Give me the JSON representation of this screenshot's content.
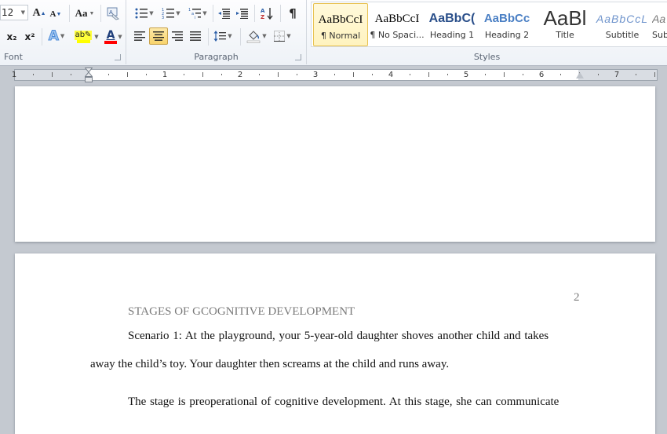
{
  "ribbon": {
    "font_group": {
      "label": "Font",
      "font_size": "12",
      "grow_font": "A",
      "shrink_font": "A",
      "change_case": "Aa",
      "subscript": "x₂",
      "superscript": "x²",
      "text_effects": "A",
      "highlight": "ab",
      "font_color": "A",
      "highlight_color": "#ffff00",
      "font_color_value": "#ff0000"
    },
    "paragraph_group": {
      "label": "Paragraph",
      "pilcrow": "¶",
      "active_alignment": "center"
    },
    "styles_group": {
      "label": "Styles",
      "items": [
        {
          "preview": "AaBbCcI",
          "name": "¶ Normal",
          "selected": true
        },
        {
          "preview": "AaBbCcI",
          "name": "¶ No Spaci...",
          "selected": false
        },
        {
          "preview": "AaBbC(",
          "name": "Heading 1",
          "selected": false
        },
        {
          "preview": "AaBbCc",
          "name": "Heading 2",
          "selected": false
        },
        {
          "preview": "AaBl",
          "name": "Title",
          "selected": false
        },
        {
          "preview": "AaBbCcL",
          "name": "Subtitle",
          "selected": false
        },
        {
          "preview": "Aa",
          "name": "Sub",
          "selected": false
        }
      ]
    }
  },
  "ruler": {
    "numbers": [
      "1",
      "1",
      "2",
      "3",
      "4",
      "5",
      "6",
      "7"
    ]
  },
  "document": {
    "page_number": "2",
    "running_head": "STAGES OF GCOGNITIVE DEVELOPMENT",
    "paragraphs": [
      {
        "lines": [
          "Scenario 1: At the playground, your 5-year-old daughter shoves another child and takes",
          "away the child’s toy. Your daughter then screams at the child and runs away."
        ]
      },
      {
        "lines": [
          "The stage is preoperational of cognitive development. At this stage, she can communicate"
        ]
      }
    ]
  }
}
